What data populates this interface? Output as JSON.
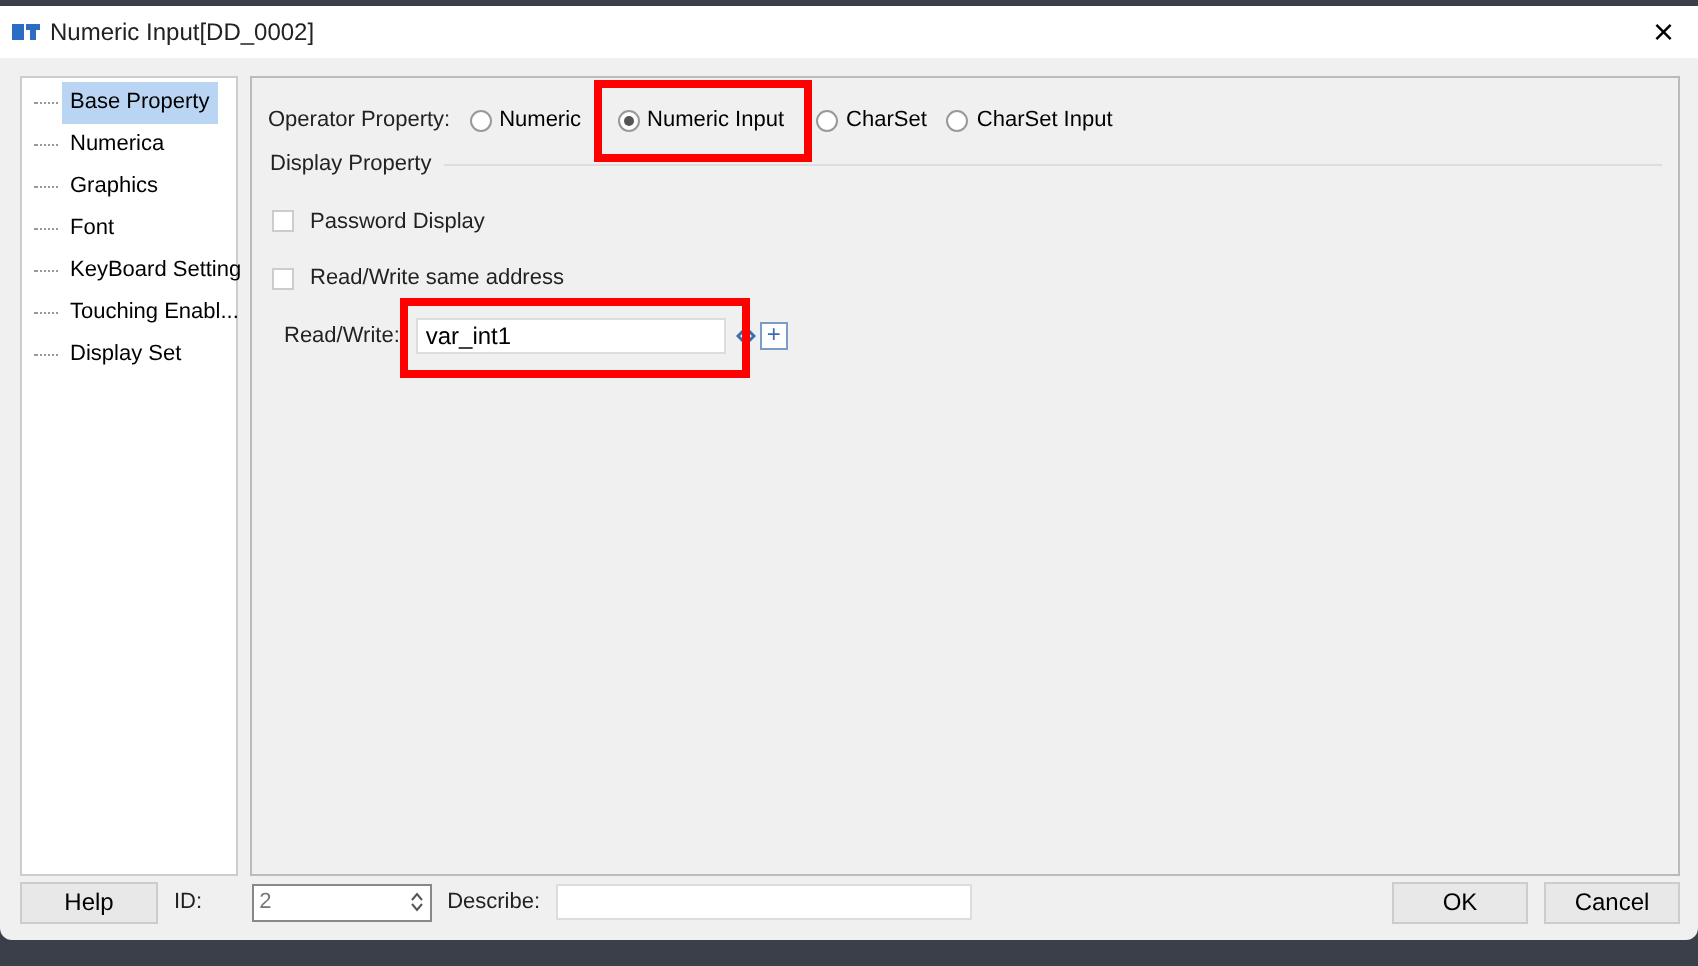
{
  "window": {
    "title": "Numeric Input[DD_0002]",
    "close": "×"
  },
  "sidebar": {
    "items": [
      {
        "label": "Base Property",
        "selected": true
      },
      {
        "label": "Numerica",
        "selected": false
      },
      {
        "label": "Graphics",
        "selected": false
      },
      {
        "label": "Font",
        "selected": false
      },
      {
        "label": "KeyBoard Setting",
        "selected": false
      },
      {
        "label": "Touching Enabl...",
        "selected": false
      },
      {
        "label": "Display Set",
        "selected": false
      }
    ]
  },
  "operator_property": {
    "label": "Operator Property:",
    "options": [
      {
        "label": "Numeric",
        "selected": false,
        "highlighted": false
      },
      {
        "label": "Numeric Input",
        "selected": true,
        "highlighted": true
      },
      {
        "label": "CharSet",
        "selected": false,
        "highlighted": false
      },
      {
        "label": "CharSet Input",
        "selected": false,
        "highlighted": false
      }
    ]
  },
  "display_property": {
    "title": "Display Property",
    "checkboxes": [
      {
        "label": "Password Display",
        "checked": false
      },
      {
        "label": "Read/Write same address",
        "checked": false
      }
    ],
    "read_write": {
      "label": "Read/Write:",
      "value": "var_int1",
      "highlighted": true,
      "add": "+"
    }
  },
  "footer": {
    "help": "Help",
    "id_label": "ID:",
    "id_value": "2",
    "describe_label": "Describe:",
    "buttons": [
      "OK",
      "Cancel"
    ]
  }
}
